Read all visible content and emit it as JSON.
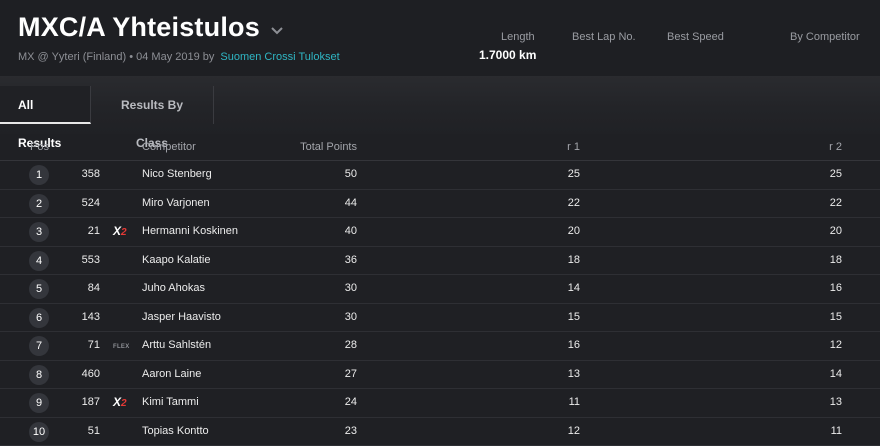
{
  "event": {
    "title": "MXC/A Yhteistulos",
    "subtitle_prefix": "MX @ Yyteri (Finland) • 04 May 2019 by",
    "organizer_link": "Suomen Crossi Tulokset"
  },
  "meta": {
    "length_label": "Length",
    "length_value": "1.7000 km",
    "best_lap_label": "Best Lap No.",
    "best_speed_label": "Best Speed",
    "by_competitor_label": "By Competitor"
  },
  "tabs": [
    {
      "label": "All Results",
      "active": true
    },
    {
      "label": "Results By Class",
      "active": false
    }
  ],
  "columns": {
    "pos": "Pos",
    "competitor": "Competitor",
    "total_points": "Total Points",
    "r1": "r 1",
    "r2": "r 2"
  },
  "rows": [
    {
      "pos": "1",
      "number": "358",
      "brand": "",
      "competitor": "Nico Stenberg",
      "points": "50",
      "r1": "25",
      "r2": "25"
    },
    {
      "pos": "2",
      "number": "524",
      "brand": "",
      "competitor": "Miro Varjonen",
      "points": "44",
      "r1": "22",
      "r2": "22"
    },
    {
      "pos": "3",
      "number": "21",
      "brand": "x2-logo-icon",
      "competitor": "Hermanni Koskinen",
      "points": "40",
      "r1": "20",
      "r2": "20"
    },
    {
      "pos": "4",
      "number": "553",
      "brand": "",
      "competitor": "Kaapo Kalatie",
      "points": "36",
      "r1": "18",
      "r2": "18"
    },
    {
      "pos": "5",
      "number": "84",
      "brand": "",
      "competitor": "Juho Ahokas",
      "points": "30",
      "r1": "14",
      "r2": "16"
    },
    {
      "pos": "6",
      "number": "143",
      "brand": "",
      "competitor": "Jasper Haavisto",
      "points": "30",
      "r1": "15",
      "r2": "15"
    },
    {
      "pos": "7",
      "number": "71",
      "brand": "flex-logo-icon",
      "competitor": "Arttu Sahlstén",
      "points": "28",
      "r1": "16",
      "r2": "12"
    },
    {
      "pos": "8",
      "number": "460",
      "brand": "",
      "competitor": "Aaron Laine",
      "points": "27",
      "r1": "13",
      "r2": "14"
    },
    {
      "pos": "9",
      "number": "187",
      "brand": "x2-logo-icon",
      "competitor": "Kimi Tammi",
      "points": "24",
      "r1": "11",
      "r2": "13"
    },
    {
      "pos": "10",
      "number": "51",
      "brand": "",
      "competitor": "Topias Kontto",
      "points": "23",
      "r1": "12",
      "r2": "11"
    }
  ],
  "colors": {
    "background": "#1f2024",
    "link": "#2fb6c4",
    "badge": "#34363c",
    "x2_accent": "#e53935"
  }
}
